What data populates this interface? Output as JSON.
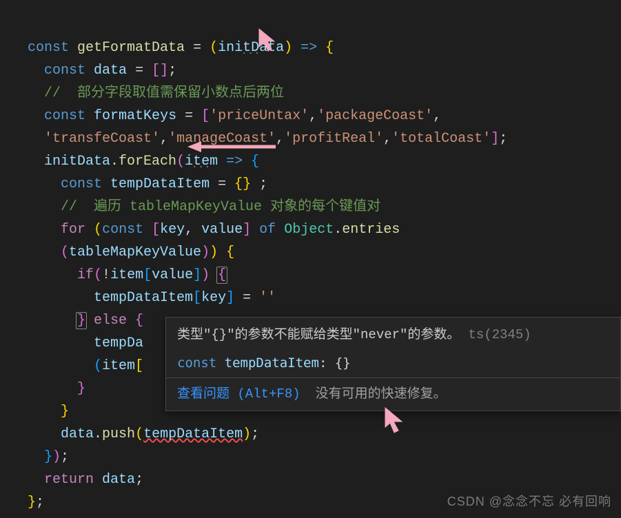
{
  "code": {
    "l1": {
      "const": "const",
      "fn": "getFormatData",
      "eq": " = ",
      "lp": "(",
      "param": "initData",
      "rp": ")",
      "arrow": " => ",
      "lb": "{"
    },
    "l2": {
      "const": "const",
      "name": "data",
      "eq": " = ",
      "lb": "[",
      "rb": "]",
      "semi": ";"
    },
    "l3": {
      "comment": "//  部分字段取值需保留小数点后两位"
    },
    "l4": {
      "const": "const",
      "name": "formatKeys",
      "eq": " = ",
      "lb": "[",
      "s1": "'priceUntax'",
      "c": ",",
      "s2": "'packageCoast'",
      "rb": ","
    },
    "l5": {
      "s1": "'transfeCoast'",
      "c1": ",",
      "s2": "'manageCoast'",
      "c2": ",",
      "s3": "'profitReal'",
      "c3": ",",
      "s4": "'totalCoast'",
      "rb": "]",
      "semi": ";"
    },
    "l6": {
      "obj": "initData",
      "dot": ".",
      "method": "forEach",
      "lp": "(",
      "param": "item",
      "arrow": " => ",
      "lb": "{"
    },
    "l7": {
      "const": "const",
      "name": "tempDataItem",
      "eq": " = ",
      "lb": "{",
      "rb": "}",
      "sp": " ",
      "semi": ";"
    },
    "l8": {
      "comment1": "//  遍历 ",
      "ident": "tableMapKeyValue",
      "comment2": " 对象的每个键值对"
    },
    "l9": {
      "for": "for",
      "lp": "(",
      "const": "const",
      "lb": "[",
      "k": "key",
      "c": ", ",
      "v": "value",
      "rb": "]",
      "of": " of ",
      "obj": "Object",
      "dot": ".",
      "method": "entries"
    },
    "l10": {
      "lp": "(",
      "name": "tableMapKeyValue",
      "rp": ")",
      "rp2": ")",
      "sp": " ",
      "lb": "{"
    },
    "l11": {
      "if": "if",
      "lp": "(",
      "not": "!",
      "item": "item",
      "lb": "[",
      "val": "value",
      "rb": "]",
      "rp": ")",
      "lbrace": "{"
    },
    "l12": {
      "obj": "tempDataItem",
      "lb": "[",
      "key": "key",
      "rb": "]",
      "eq": " = ",
      "str": "''"
    },
    "l13": {
      "rb": "}",
      "else": " else ",
      "lb": "{"
    },
    "l14": {
      "obj": "tempDa"
    },
    "l15": {
      "lp": "(",
      "item": "item",
      "lb": "["
    },
    "l16": {
      "rb": "}"
    },
    "l17": {
      "rb": "}"
    },
    "l18": {
      "obj": "data",
      "dot": ".",
      "method": "push",
      "lp": "(",
      "arg": "tempDataItem",
      "rp": ")",
      "semi": ";"
    },
    "l19": {
      "rb": "}",
      "rp": ")",
      "semi": ";"
    },
    "l20": {
      "ret": "return",
      "name": "data",
      "semi": ";"
    },
    "l21": {
      "rb": "}",
      "semi": ";"
    }
  },
  "tooltip": {
    "err": "类型\"{}\"的参数不能赋给类型\"never\"的参数。",
    "tscode": "ts(2345)",
    "code_kw": "const",
    "code_name": "tempDataItem",
    "code_rest": ": {}",
    "link": "查看问题 (Alt+F8)",
    "nofix": "没有可用的快速修复。"
  },
  "watermark": "CSDN @念念不忘  必有回响"
}
